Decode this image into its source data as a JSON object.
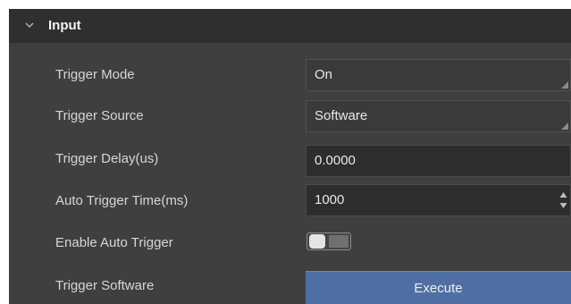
{
  "section": {
    "title": "Input"
  },
  "rows": {
    "trigger_mode": {
      "label": "Trigger Mode",
      "value": "On"
    },
    "trigger_source": {
      "label": "Trigger Source",
      "value": "Software"
    },
    "trigger_delay": {
      "label": "Trigger Delay(us)",
      "value": "0.0000"
    },
    "auto_trigger_time": {
      "label": "Auto Trigger Time(ms)",
      "value": "1000"
    },
    "enable_auto_trigger": {
      "label": "Enable Auto Trigger",
      "state": "off"
    },
    "trigger_software": {
      "label": "Trigger Software",
      "button_label": "Execute"
    }
  },
  "colors": {
    "panel_background": "#3f3f40",
    "header_background": "#2f2f30",
    "accent_button": "#4f6ea3"
  },
  "icons": {
    "section_toggle": "chevron-down-icon",
    "dropdown": "dropdown-corner-icon",
    "spinner": "spinner-arrows-icon"
  }
}
